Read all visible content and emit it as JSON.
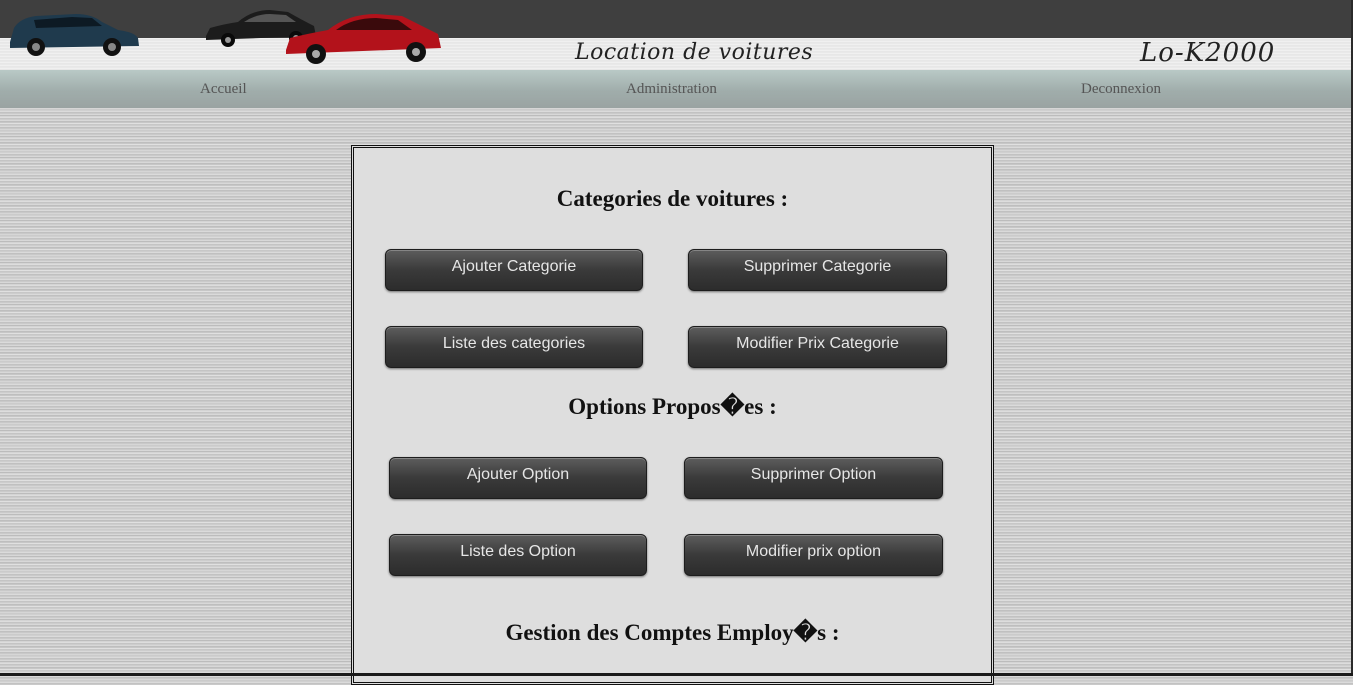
{
  "header": {
    "title": "Location de voitures",
    "brand": "Lo-K2000"
  },
  "nav": {
    "items": [
      {
        "label": "Accueil"
      },
      {
        "label": "Administration"
      },
      {
        "label": "Deconnexion"
      }
    ]
  },
  "sections": {
    "categories": {
      "title": "Categories de voitures :",
      "buttons": [
        "Ajouter Categorie",
        "Supprimer Categorie",
        "Liste des categories",
        "Modifier Prix Categorie"
      ]
    },
    "options": {
      "title": "Options Propos�es :",
      "buttons": [
        "Ajouter Option",
        "Supprimer Option",
        "Liste des Option",
        "Modifier prix option"
      ]
    },
    "accounts": {
      "title": "Gestion des Comptes Employ�s :"
    }
  },
  "colors": {
    "header_band": "#3f3f3f",
    "nav_gradient_top": "#b9c9c6",
    "button_dark": "#3a3a3a",
    "panel_bg": "#dedede",
    "car_red": "#b3121b",
    "car_dark_blue": "#1f3a4d",
    "car_black": "#1c1c1c"
  }
}
